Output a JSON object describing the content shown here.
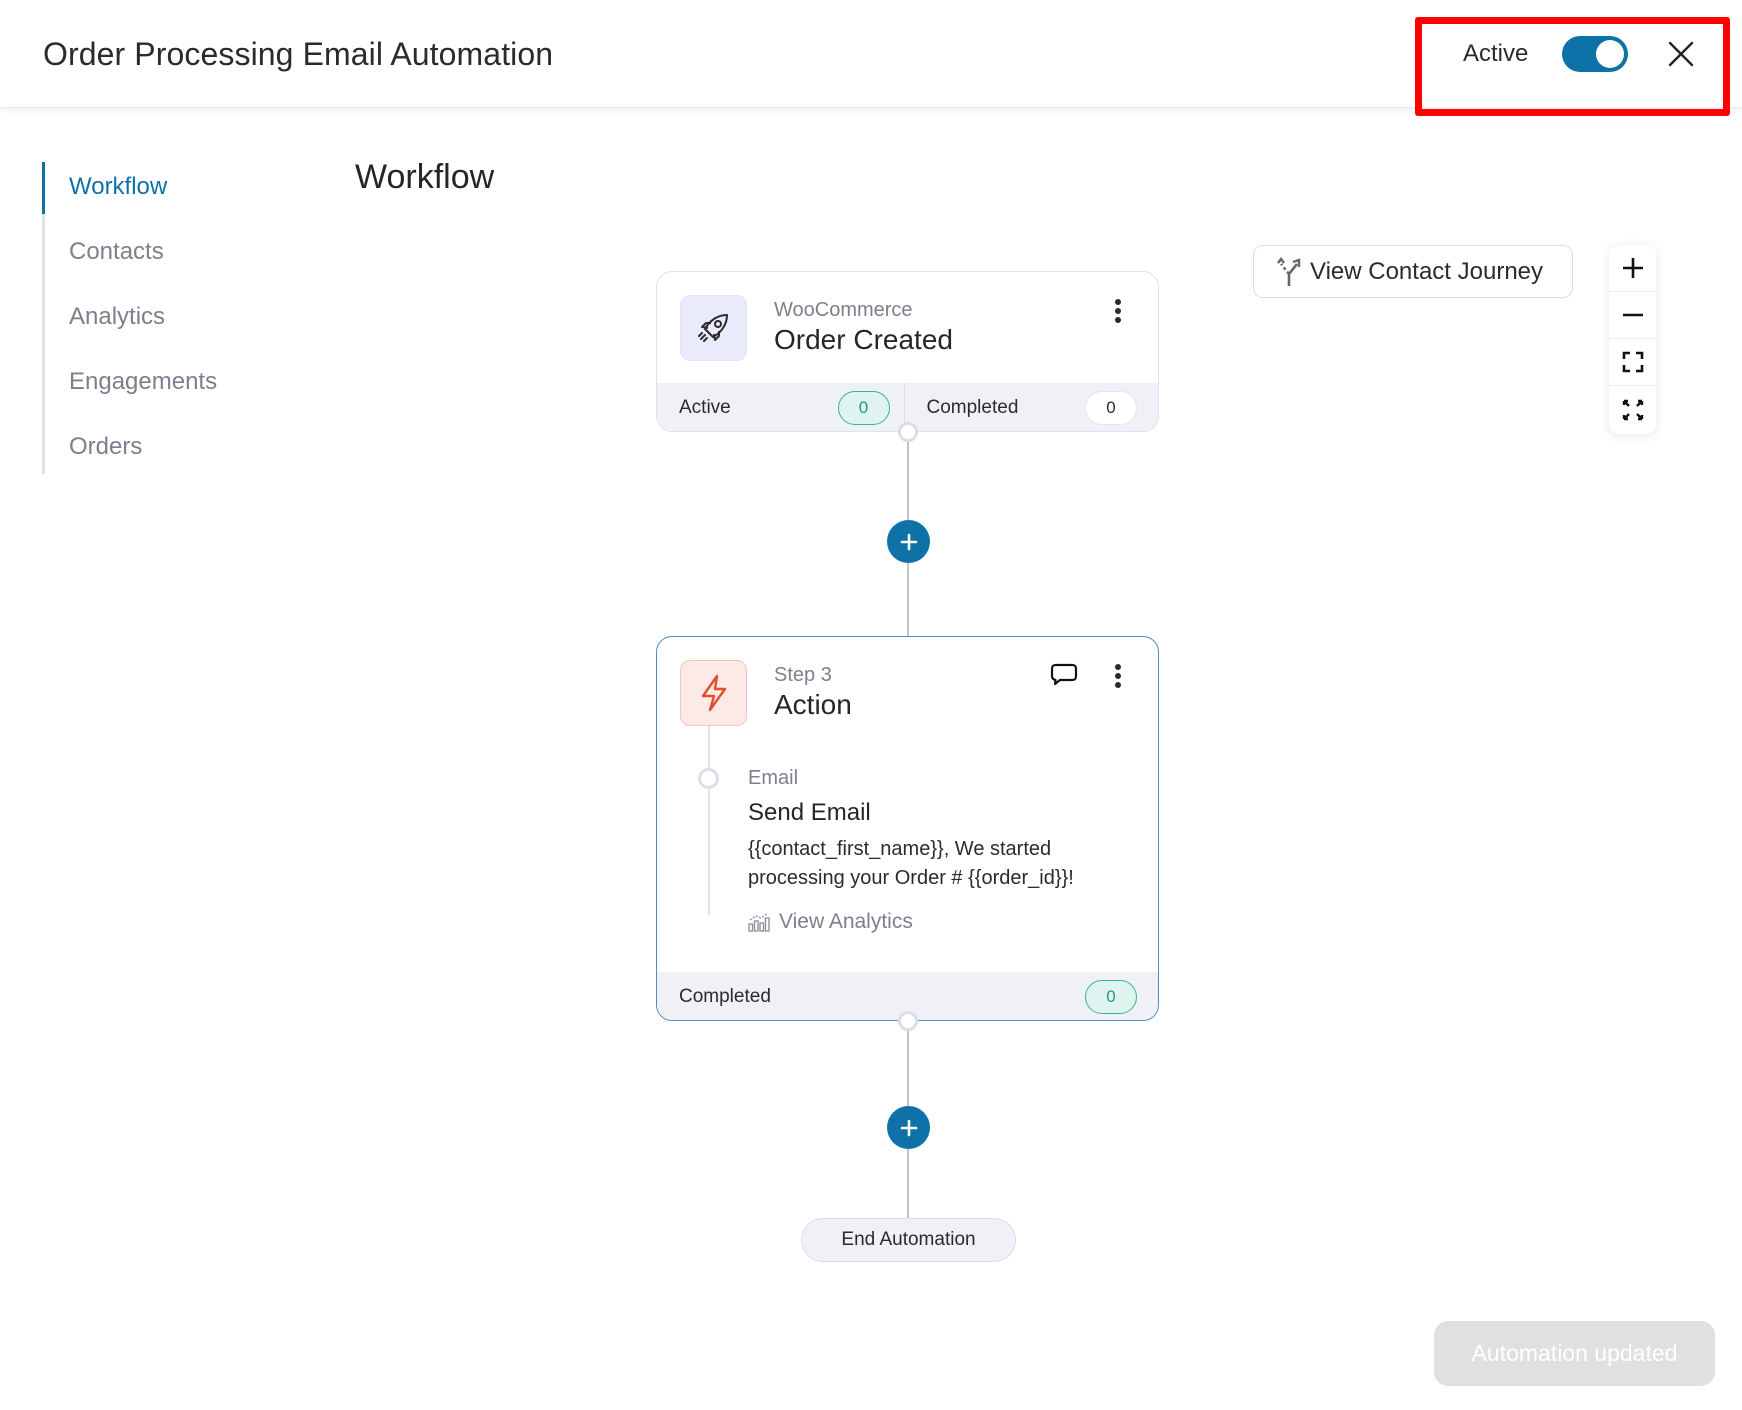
{
  "header": {
    "title": "Order Processing Email Automation",
    "status_label": "Active",
    "status_toggle_on": true,
    "close_icon": "close-icon",
    "highlight_color": "#ff0000"
  },
  "sidebar": {
    "items": [
      {
        "label": "Workflow",
        "active": true
      },
      {
        "label": "Contacts",
        "active": false
      },
      {
        "label": "Analytics",
        "active": false
      },
      {
        "label": "Engagements",
        "active": false
      },
      {
        "label": "Orders",
        "active": false
      }
    ]
  },
  "main": {
    "heading": "Workflow",
    "journey_button": {
      "label": "View Contact Journey",
      "icon": "fork-arrows-icon"
    },
    "zoom_controls": [
      {
        "name": "zoom-in",
        "icon": "plus-icon"
      },
      {
        "name": "zoom-out",
        "icon": "minus-icon"
      },
      {
        "name": "fit-view",
        "icon": "frame-corners-icon"
      },
      {
        "name": "fullscreen",
        "icon": "expand-arrows-icon"
      }
    ]
  },
  "workflow": {
    "trigger": {
      "icon": "rocket-icon",
      "source": "WooCommerce",
      "title": "Order Created",
      "stats": {
        "active_label": "Active",
        "active_count": "0",
        "completed_label": "Completed",
        "completed_count": "0"
      }
    },
    "action": {
      "icon": "lightning-icon",
      "step_label": "Step 3",
      "title": "Action",
      "email": {
        "type": "Email",
        "title": "Send Email",
        "subject": "{{contact_first_name}}, We started processing your Order # {{order_id}}!",
        "analytics_label": "View Analytics"
      },
      "footer": {
        "completed_label": "Completed",
        "completed_count": "0"
      }
    },
    "end_label": "End Automation"
  },
  "toast": {
    "label": "Automation updated"
  },
  "colors": {
    "accent": "#0e72a8",
    "success": "#35b59a",
    "action_icon": "#e0502f"
  }
}
